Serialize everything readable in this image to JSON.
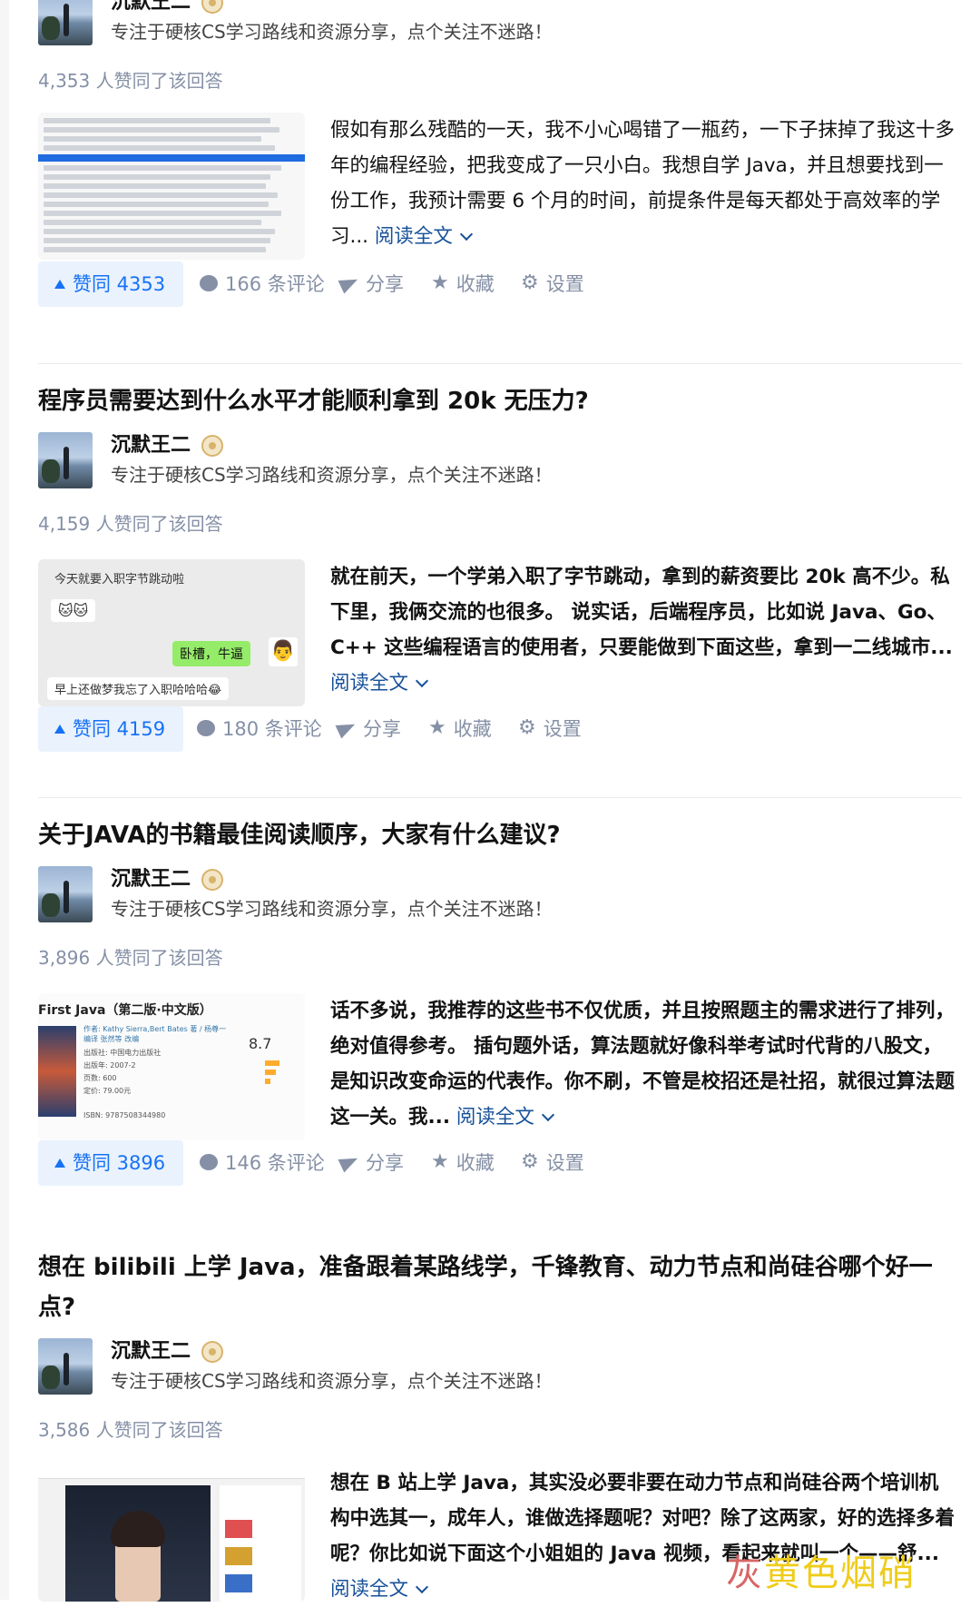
{
  "author": {
    "name": "沉默王二",
    "bio": "专注于硬核CS学习路线和资源分享，点个关注不迷路！"
  },
  "actions_labels": {
    "share": "分享",
    "favorite": "收藏",
    "settings": "设置"
  },
  "read_more": "阅读全文",
  "answers": [
    {
      "title": "",
      "agree_text": "4,353 人赞同了该回答",
      "excerpt": "假如有那么残酷的一天，我不小心喝错了一瓶药，一下子抹掉了我这十多年的编程经验，把我变成了一只小白。我想自学 Java，并且想要找到一份工作，我预计需要 6 个月的时间，前提条件是每天都处于高效率的学习...",
      "vote": "赞同 4353",
      "comments": "166 条评论"
    },
    {
      "title": "程序员需要达到什么水平才能顺利拿到 20k 无压力?",
      "agree_text": "4,159 人赞同了该回答",
      "excerpt": "就在前天，一个学弟入职了字节跳动，拿到的薪资要比 20k 高不少。私下里，我俩交流的也很多。 说实话，后端程序员，比如说 Java、Go、C++ 这些编程语言的使用者，只要能做到下面这些，拿到一二线城市...",
      "vote": "赞同 4159",
      "comments": "180 条评论",
      "thumb_texts": [
        "今天就要入职字节跳动啦",
        "卧槽，牛逼",
        "早上还做梦我忘了入职哈哈哈😂"
      ]
    },
    {
      "title": "关于JAVA的书籍最佳阅读顺序，大家有什么建议?",
      "agree_text": "3,896 人赞同了该回答",
      "excerpt": "话不多说，我推荐的这些书不仅优质，并且按照题主的需求进行了排列，绝对值得参考。 插句题外话，算法题就好像科举考试时代背的八股文，是知识改变命运的代表作。你不刷，不管是校招还是社招，就很过算法题这一关。我...",
      "vote": "赞同 3896",
      "comments": "146 条评论",
      "thumb_texts": [
        "First Java（第二版·中文版）",
        "8.7",
        "作者: Kathy Sierra,Bert Bates 著 / 杨尊一 编译 张然等 改编",
        "出版社: 中国电力出版社",
        "出版年: 2007-2",
        "页数: 600",
        "定价: 79.00元",
        "ISBN: 9787508344980"
      ]
    },
    {
      "title": "想在 bilibili 上学 Java，准备跟着某路线学，千锋教育、动力节点和尚硅谷哪个好一点?",
      "agree_text": "3,586 人赞同了该回答",
      "excerpt": "想在 B 站上学 Java，其实没必要非要在动力节点和尚硅谷两个培训机构中选其一，成年人，谁做选择题呢？对吧？除了这两家，好的选择多着呢？你比如说下面这个小姐姐的 Java 视频，看起来就叫一个——舒...",
      "vote": "",
      "comments": ""
    }
  ],
  "watermark": {
    "part1": "灰",
    "part2": "黄色烟硝"
  }
}
